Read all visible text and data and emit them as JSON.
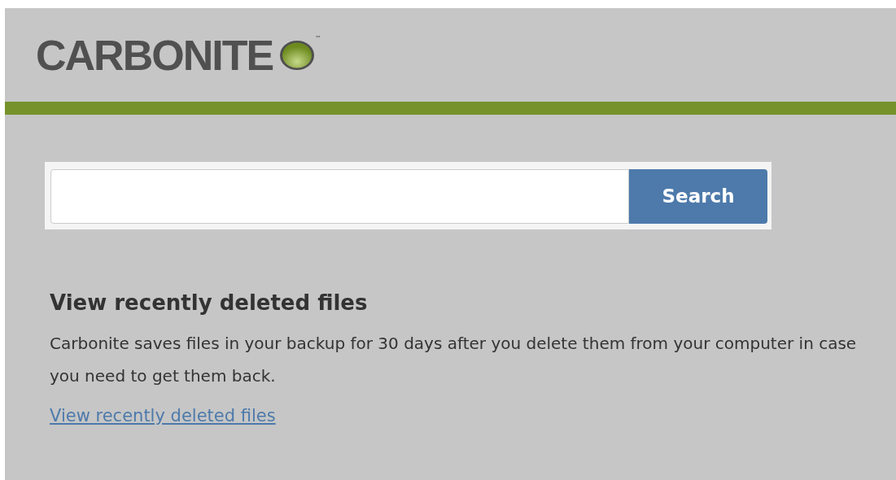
{
  "header": {
    "logo": "CARBONITE",
    "trademark": "™"
  },
  "search": {
    "button": "Search"
  },
  "section": {
    "title": "View recently deleted files",
    "text": "Carbonite saves files in your backup for 30 days after you delete them from your computer in case you need to get them back.",
    "link": "View recently deleted files"
  }
}
